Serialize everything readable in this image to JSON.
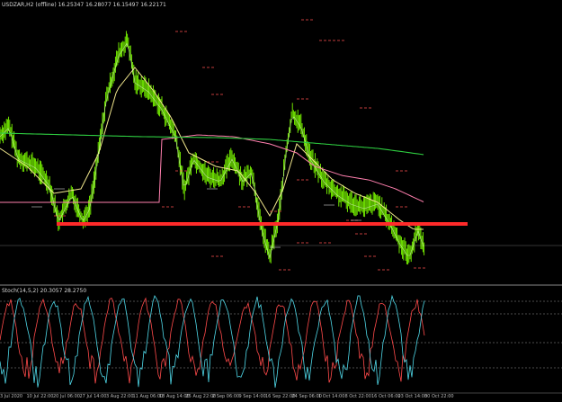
{
  "chart": {
    "title": "USDZAR,H2 (offline)",
    "ohlc": "16.25347 16.28077 16.15497 16.22171",
    "indicator_title": "Stoch(14,5,2) 20.3057 28.2750",
    "dates": [
      "3 Jul 2020",
      "10 Jul 22:00",
      "20 Jul 06:00",
      "27 Jul 14:00",
      "3 Aug 22:00",
      "11 Aug 06:00",
      "18 Aug 14:00",
      "25 Aug 22:00",
      "2 Sep 06:00",
      "9 Sep 14:00",
      "16 Sep 22:00",
      "24 Sep 06:00",
      "1 Oct 14:00",
      "8 Oct 22:00",
      "16 Oct 06:00",
      "23 Oct 14:00",
      "30 Oct 22:00"
    ]
  },
  "colors": {
    "background": "#000000",
    "price": "#7CFC00",
    "ma_fast": "#e0ef5a",
    "ma_mid": "#f0e68c",
    "ma_slow_pink": "#ff7fae",
    "ma_long_green": "#2ecc40",
    "support_line": "#ff2a2a",
    "stoch_main": "#4fd8e8",
    "stoch_signal": "#ff4a4a",
    "level_dash": "#ff5050"
  }
}
